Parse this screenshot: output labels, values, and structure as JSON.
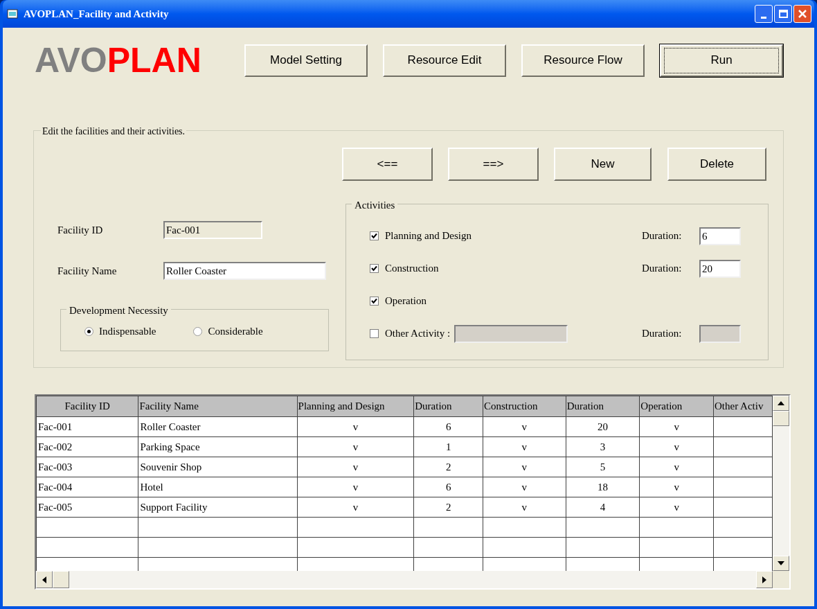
{
  "window": {
    "title": "AVOPLAN_Facility and Activity"
  },
  "logo": {
    "part_1": "AVO",
    "part_2": "PLAN"
  },
  "top_buttons": [
    {
      "label": "Model Setting",
      "focused": false
    },
    {
      "label": "Resource Edit",
      "focused": false
    },
    {
      "label": "Resource Flow",
      "focused": false
    },
    {
      "label": "Run",
      "focused": true
    }
  ],
  "editor": {
    "title": "Edit the facilities and their activities.",
    "nav_buttons": [
      "<==",
      "==>",
      "New",
      "Delete"
    ],
    "facility_id": {
      "label": "Facility ID",
      "value": "Fac-001",
      "disabled": true
    },
    "facility_name": {
      "label": "Facility Name",
      "value": "Roller Coaster",
      "disabled": false
    },
    "development_necessity": {
      "title": "Development Necessity",
      "options": [
        {
          "label": "Indispensable",
          "selected": true
        },
        {
          "label": "Considerable",
          "selected": false
        }
      ]
    },
    "activities": {
      "title": "Activities",
      "items": [
        {
          "kind": "standard",
          "label": "Planning and Design",
          "checked": true,
          "duration_label": "Duration:",
          "duration": "6"
        },
        {
          "kind": "standard",
          "label": "Construction",
          "checked": true,
          "duration_label": "Duration:",
          "duration": "20"
        },
        {
          "kind": "plain",
          "label": "Operation",
          "checked": true
        },
        {
          "kind": "other",
          "label": "Other Activity :",
          "checked": false,
          "duration_label": "Duration:"
        }
      ]
    }
  },
  "table": {
    "columns": [
      "Facility ID",
      "Facility Name",
      "Planning and Design",
      "Duration",
      "Construction",
      "Duration",
      "Operation",
      "Other Activ"
    ],
    "rows": [
      [
        "Fac-001",
        "Roller Coaster",
        "v",
        "6",
        "v",
        "20",
        "v"
      ],
      [
        "Fac-002",
        "Parking Space",
        "v",
        "1",
        "v",
        "3",
        "v"
      ],
      [
        "Fac-003",
        "Souvenir Shop",
        "v",
        "2",
        "v",
        "5",
        "v"
      ],
      [
        "Fac-004",
        "Hotel",
        "v",
        "6",
        "v",
        "18",
        "v"
      ],
      [
        "Fac-005",
        "Support Facility",
        "v",
        "2",
        "v",
        "4",
        "v"
      ]
    ]
  }
}
